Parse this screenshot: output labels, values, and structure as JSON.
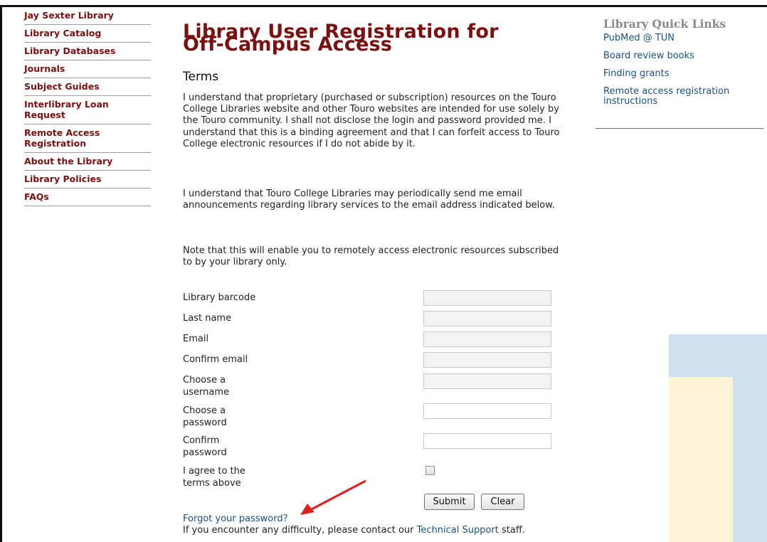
{
  "sidebar": {
    "items": [
      {
        "label": "Jay Sexter Library"
      },
      {
        "label": "Library Catalog"
      },
      {
        "label": "Library Databases"
      },
      {
        "label": "Journals"
      },
      {
        "label": "Subject Guides"
      },
      {
        "label": "Interlibrary Loan Request"
      },
      {
        "label": "Remote Access Registration"
      },
      {
        "label": "About the Library"
      },
      {
        "label": "Library Policies"
      },
      {
        "label": "FAQs"
      }
    ]
  },
  "main": {
    "title_line1": "Library User Registration for",
    "title_line2": "Off-Campus Access",
    "terms_heading": "Terms",
    "para1": "I understand that proprietary (purchased or subscription) resources on the Touro College Libraries website and other Touro websites are intended for use solely by the Touro community. I shall not disclose the login and password provided me. I understand that this is a binding agreement and that I can forfeit access to Touro College electronic resources if I do not abide by it.",
    "para2": "I understand that Touro College Libraries may periodically send me email announcements regarding library services to the email address indicated below.",
    "para3": "Note that this will enable you to remotely access electronic resources subscribed to by your library only."
  },
  "form": {
    "barcode_label": "Library barcode",
    "lastname_label": "Last name",
    "email_label": "Email",
    "confirm_email_label": "Confirm email",
    "username_label": "Choose a username",
    "password_label": "Choose a password",
    "confirm_password_label": "Confirm password",
    "agree_label": "I agree to the terms above",
    "barcode_value": "",
    "lastname_value": "",
    "email_value": "",
    "confirm_email_value": "",
    "username_value": "",
    "password_value": "",
    "confirm_password_value": "",
    "agree_checked": false,
    "submit_label": "Submit",
    "clear_label": "Clear"
  },
  "footer": {
    "forgot_link": "Forgot your password?",
    "support_prefix": "If you encounter any difficulty, please contact our ",
    "support_link": "Technical Support",
    "support_suffix": " staff."
  },
  "quick_links": {
    "title": "Library Quick Links",
    "items": [
      {
        "label": "PubMed @ TUN"
      },
      {
        "label": "Board review books"
      },
      {
        "label": "Finding grants"
      },
      {
        "label": "Remote access registration instructions"
      }
    ]
  },
  "colors": {
    "sidebar_link": "#7a1010",
    "title": "#7a1010",
    "link": "#1a4f8a",
    "annotation_arrow": "#e02020"
  }
}
